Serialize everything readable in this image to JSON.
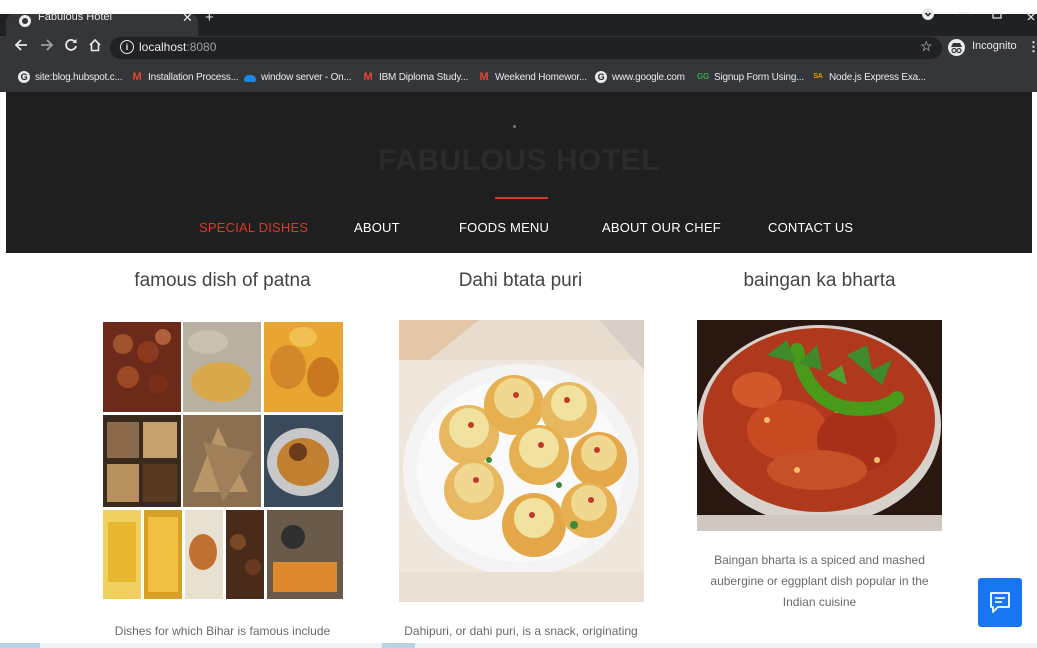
{
  "browser": {
    "tab_title": "Fabulous Hotel",
    "tab_close": "✕",
    "new_tab": "+",
    "url_host": "localhost",
    "url_port": ":8080",
    "incognito_label": "Incognito",
    "bookmarks": [
      {
        "label": "site:blog.hubspot.c...",
        "icon": "google-icon"
      },
      {
        "label": "Installation Process...",
        "icon": "gmail-icon"
      },
      {
        "label": "window server - On...",
        "icon": "onedrive-icon"
      },
      {
        "label": "IBM Diploma Study...",
        "icon": "gmail-icon"
      },
      {
        "label": "Weekend Homewor...",
        "icon": "gmail-icon"
      },
      {
        "label": "www.google.com",
        "icon": "google-icon"
      },
      {
        "label": "Signup Form Using...",
        "icon": "gg-icon"
      },
      {
        "label": "Node.js Express Exa...",
        "icon": "sa-icon"
      }
    ]
  },
  "site": {
    "title": "FABULOUS HOTEL",
    "nav": [
      {
        "label": "SPECIAL DISHES",
        "active": true
      },
      {
        "label": "ABOUT",
        "active": false
      },
      {
        "label": "FOODS MENU",
        "active": false
      },
      {
        "label": "ABOUT OUR CHEF",
        "active": false
      },
      {
        "label": "CONTACT US",
        "active": false
      }
    ],
    "accent_color": "#d63a2f",
    "header_bg": "#1f1f1f"
  },
  "dishes": [
    {
      "title": "famous dish of patna",
      "description_lines": [
        "Dishes for which Bihar is famous include"
      ]
    },
    {
      "title": "Dahi btata puri",
      "description_lines": [
        "Dahipuri, or dahi puri, is a snack, originating"
      ]
    },
    {
      "title": "baingan ka bharta",
      "description_lines": [
        "Baingan bharta is a spiced and mashed",
        "aubergine or eggplant dish popular in the",
        "Indian cuisine"
      ]
    }
  ],
  "chat_widget": {
    "icon": "chat-icon",
    "color": "#1976f2"
  }
}
